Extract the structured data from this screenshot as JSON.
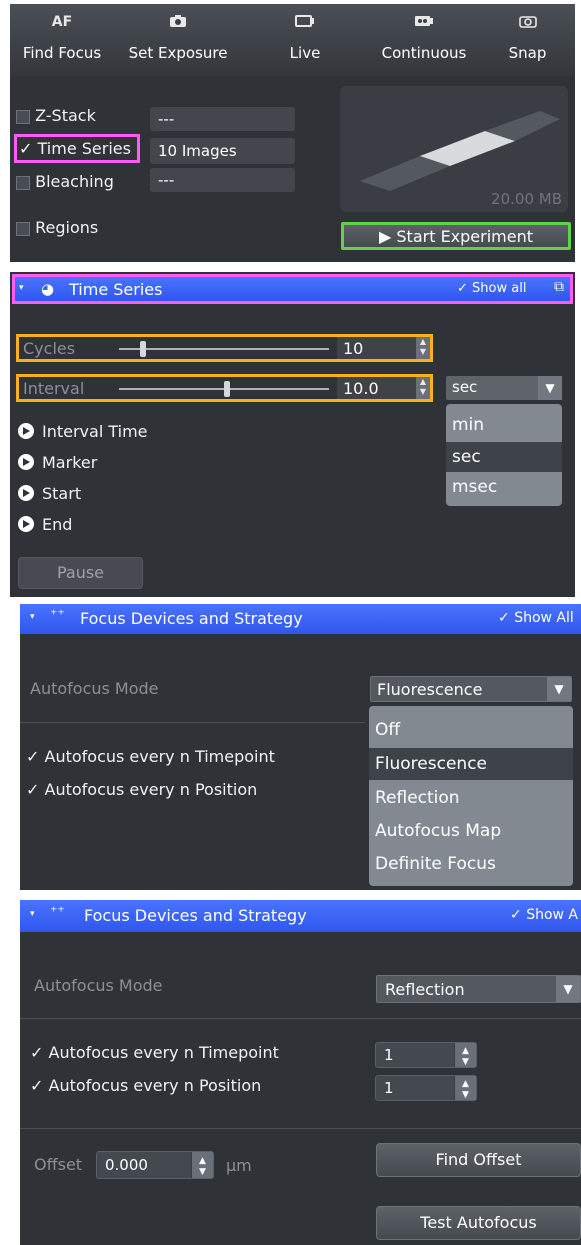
{
  "toolbar": {
    "buttons": [
      {
        "icon": "AF",
        "label": "Find Focus"
      },
      {
        "icon": "camera-icon",
        "label": "Set Exposure"
      },
      {
        "icon": "live-icon",
        "label": "Live"
      },
      {
        "icon": "continuous-icon",
        "label": "Continuous"
      },
      {
        "icon": "snap-icon",
        "label": "Snap"
      }
    ]
  },
  "experiment": {
    "options": [
      {
        "label": "Z-Stack",
        "checked": false,
        "value": "---"
      },
      {
        "label": "Time Series",
        "checked": true,
        "value": "10 Images"
      },
      {
        "label": "Bleaching",
        "checked": false,
        "value": "---"
      },
      {
        "label": "Regions",
        "checked": false
      }
    ],
    "size": "20.00 MB",
    "start_label": "Start Experiment"
  },
  "time_series": {
    "title": "Time Series",
    "show_all": "Show all",
    "cycles_label": "Cycles",
    "cycles_value": "10",
    "cycles_slider_level": 0.1,
    "interval_label": "Interval",
    "interval_value": "10.0",
    "interval_slider_level": 0.5,
    "unit_selected": "sec",
    "unit_options": [
      "min",
      "sec",
      "msec"
    ],
    "sections": [
      "Interval Time",
      "Marker",
      "Start",
      "End"
    ],
    "pause_label": "Pause"
  },
  "focus1": {
    "title": "Focus Devices and Strategy",
    "show_all": "Show All",
    "mode_label": "Autofocus Mode",
    "mode_value": "Fluorescence",
    "mode_options": [
      "Off",
      "Fluorescence",
      "Reflection",
      "Autofocus Map",
      "Definite Focus"
    ],
    "check1": "Autofocus every n Timepoint",
    "check2": "Autofocus every n Position"
  },
  "focus2": {
    "title": "Focus Devices and Strategy",
    "show_all": "Show A",
    "mode_label": "Autofocus Mode",
    "mode_value": "Reflection",
    "check1": "Autofocus every n Timepoint",
    "check1_value": "1",
    "check2": "Autofocus every n Position",
    "check2_value": "1",
    "offset_label": "Offset",
    "offset_value": "0.000",
    "offset_unit": "µm",
    "find_offset": "Find Offset",
    "test_autofocus": "Test Autofocus"
  },
  "colors": {
    "highlight_magenta": "#ff5cf5",
    "highlight_orange": "#f5b21b",
    "highlight_green": "#63d24a",
    "header_blue": "#3b63f5"
  }
}
